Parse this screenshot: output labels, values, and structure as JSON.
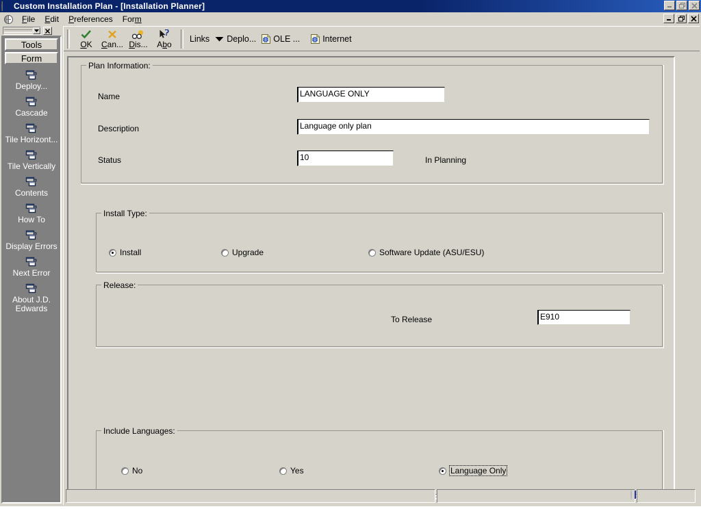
{
  "window": {
    "title": "Custom Installation Plan - [Installation Planner]",
    "app_icon": "jde-globe-icon",
    "controls": {
      "minimize": "_",
      "restore": "❐",
      "close": "✕"
    }
  },
  "menu": {
    "icon": "jde-globe-icon",
    "items": [
      {
        "label": "File",
        "accel": "F"
      },
      {
        "label": "Edit",
        "accel": "E"
      },
      {
        "label": "Preferences",
        "accel": "P"
      },
      {
        "label": "Form",
        "accel": "m"
      }
    ]
  },
  "sidebar": {
    "combo_value": "",
    "close_label": "✕",
    "tabs": [
      {
        "label": "Tools",
        "selected": false
      },
      {
        "label": "Form",
        "selected": true
      }
    ],
    "items": [
      {
        "label": "Deploy...",
        "icon": "windows-cascade-icon"
      },
      {
        "label": "Cascade",
        "icon": "windows-cascade-icon"
      },
      {
        "label": "Tile Horizont...",
        "icon": "windows-cascade-icon"
      },
      {
        "label": "Tile Vertically",
        "icon": "windows-cascade-icon"
      },
      {
        "label": "Contents",
        "icon": "windows-cascade-icon"
      },
      {
        "label": "How To",
        "icon": "windows-cascade-icon"
      },
      {
        "label": "Display Errors",
        "icon": "windows-cascade-icon"
      },
      {
        "label": "Next Error",
        "icon": "windows-cascade-icon"
      },
      {
        "label": "About J.D. Edwards",
        "icon": "windows-cascade-icon"
      }
    ]
  },
  "toolbar": {
    "buttons": [
      {
        "label": "OK",
        "accel": "O",
        "icon": "check-icon",
        "color": "#2f7f2f"
      },
      {
        "label": "Can...",
        "accel": "C",
        "icon": "cross-icon",
        "color": "#e0a020"
      },
      {
        "label": "Dis...",
        "accel": "D",
        "icon": "glasses-icon",
        "color": "#e0a020"
      },
      {
        "label": "Abo",
        "accel": "b",
        "icon": "help-cursor-icon",
        "color": "#1a1a1a"
      }
    ],
    "links_label": "Links",
    "dropdown_icon": "chevron-down-icon",
    "link_items": [
      {
        "label": "Deplo...",
        "icon": null
      },
      {
        "label": "OLE ...",
        "icon": "document-globe-icon"
      },
      {
        "label": "Internet",
        "icon": "document-globe-icon"
      }
    ]
  },
  "form": {
    "plan_information": {
      "legend": "Plan Information:",
      "fields": [
        {
          "label": "Name",
          "value": "LANGUAGE ONLY"
        },
        {
          "label": "Description",
          "value": "Language only plan"
        },
        {
          "label": "Status",
          "value": "10",
          "suffix": "In Planning"
        }
      ]
    },
    "install_type": {
      "legend": "Install Type:",
      "options": [
        {
          "label": "Install",
          "selected": true
        },
        {
          "label": "Upgrade",
          "selected": false
        },
        {
          "label": "Software Update (ASU/ESU)",
          "selected": false
        }
      ]
    },
    "release": {
      "legend": "Release:",
      "to_release_label": "To Release",
      "to_release_value": "E910"
    },
    "include_languages": {
      "legend": "Include Languages:",
      "options": [
        {
          "label": "No",
          "selected": false,
          "focused": false
        },
        {
          "label": "Yes",
          "selected": false,
          "focused": false
        },
        {
          "label": "Language Only",
          "selected": true,
          "focused": true
        }
      ]
    }
  },
  "statusbar": {
    "pane1": "",
    "pane2": "",
    "pane3": "",
    "globe_icon": "jde-globe-icon"
  },
  "colors": {
    "titlebar": "#0a246a",
    "face": "#d6d3cb",
    "sidebar": "#808080",
    "field_bg": "#ffffff",
    "accent_ok": "#2f7f2f",
    "accent_cancel": "#e0a020"
  }
}
